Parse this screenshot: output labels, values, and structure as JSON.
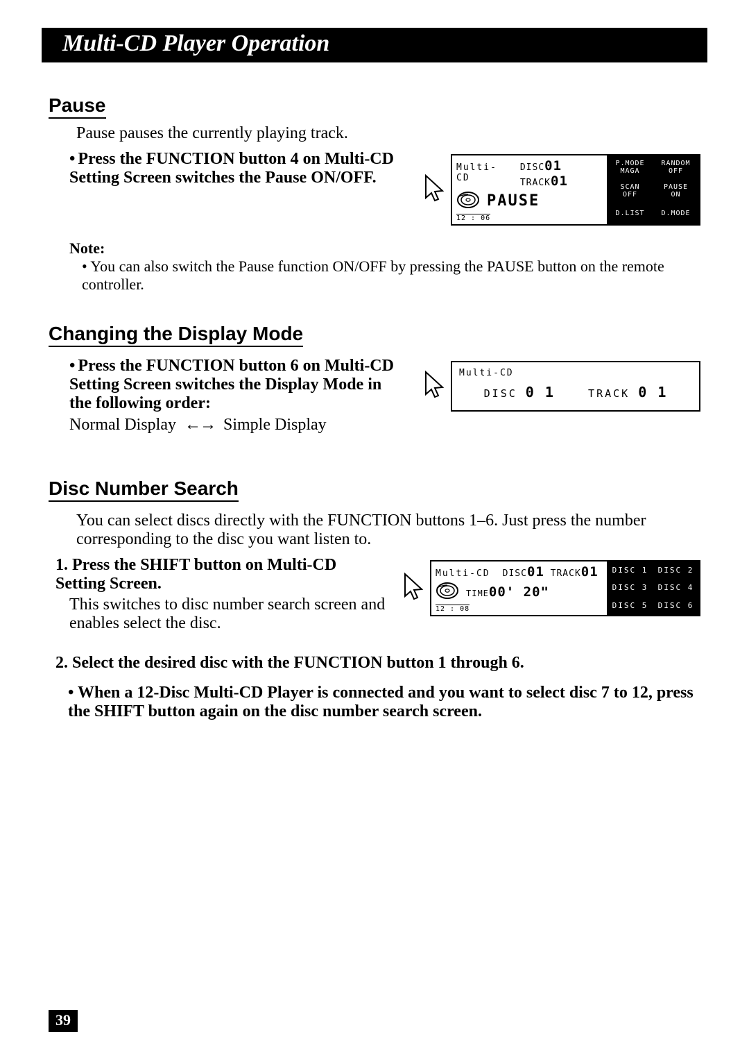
{
  "chapter_title": "Multi-CD Player Operation",
  "page_number": "39",
  "pause": {
    "heading": "Pause",
    "intro": "Pause pauses the currently playing track.",
    "step_bullet": "•",
    "step_text": "Press the FUNCTION button 4 on Multi-CD Setting Screen switches the Pause ON/OFF.",
    "note_label": "Note:",
    "note_bullet": "•",
    "note_text": "You can also switch the Pause function ON/OFF by pressing the PAUSE button on the remote controller.",
    "screen": {
      "title": "Multi-CD",
      "disc_label": "DISC",
      "disc_num": "01",
      "track_label": "TRACK",
      "track_num": "01",
      "status": "PAUSE",
      "clock": "12 : 06",
      "softkeys": [
        {
          "l1": "P.MODE",
          "l2": "MAGA"
        },
        {
          "l1": "RANDOM",
          "l2": "OFF"
        },
        {
          "l1": "SCAN",
          "l2": "OFF"
        },
        {
          "l1": "PAUSE",
          "l2": "ON"
        },
        {
          "l1": "D.LIST",
          "l2": ""
        },
        {
          "l1": "D.MODE",
          "l2": ""
        }
      ]
    }
  },
  "display_mode": {
    "heading": "Changing the Display Mode",
    "step_bullet": "•",
    "step_text": "Press the FUNCTION button 6 on Multi-CD Setting Screen switches the Display Mode in the following order:",
    "seq_left": "Normal Display",
    "seq_right": "Simple Display",
    "screen": {
      "title": "Multi-CD",
      "disc_label": "DISC",
      "disc_num": "0 1",
      "track_label": "TRACK",
      "track_num": "0 1"
    }
  },
  "disc_search": {
    "heading": "Disc Number Search",
    "intro": "You can select discs directly with the FUNCTION buttons 1–6. Just press the number corresponding to the disc you want listen to.",
    "step1_num": "1.",
    "step1_text": "Press the SHIFT button on Multi-CD Setting Screen.",
    "step1_body": "This switches to disc number search screen and enables select the disc.",
    "step2_num": "2.",
    "step2_text": "Select the desired disc with the FUNCTION button 1 through 6.",
    "sub_bullet": "•",
    "sub_text": "When a 12-Disc Multi-CD Player is connected and you want to select disc 7 to 12, press the SHIFT button again on the disc number search screen.",
    "screen": {
      "title": "Multi-CD",
      "disc_label": "DISC",
      "disc_num": "01",
      "track_label": "TRACK",
      "track_num": "01",
      "time_label": "TIME",
      "time_val": "00' 20\"",
      "clock": "12 : 08",
      "discs": [
        "DISC 1",
        "DISC 2",
        "DISC 3",
        "DISC 4",
        "DISC 5",
        "DISC 6"
      ]
    }
  }
}
